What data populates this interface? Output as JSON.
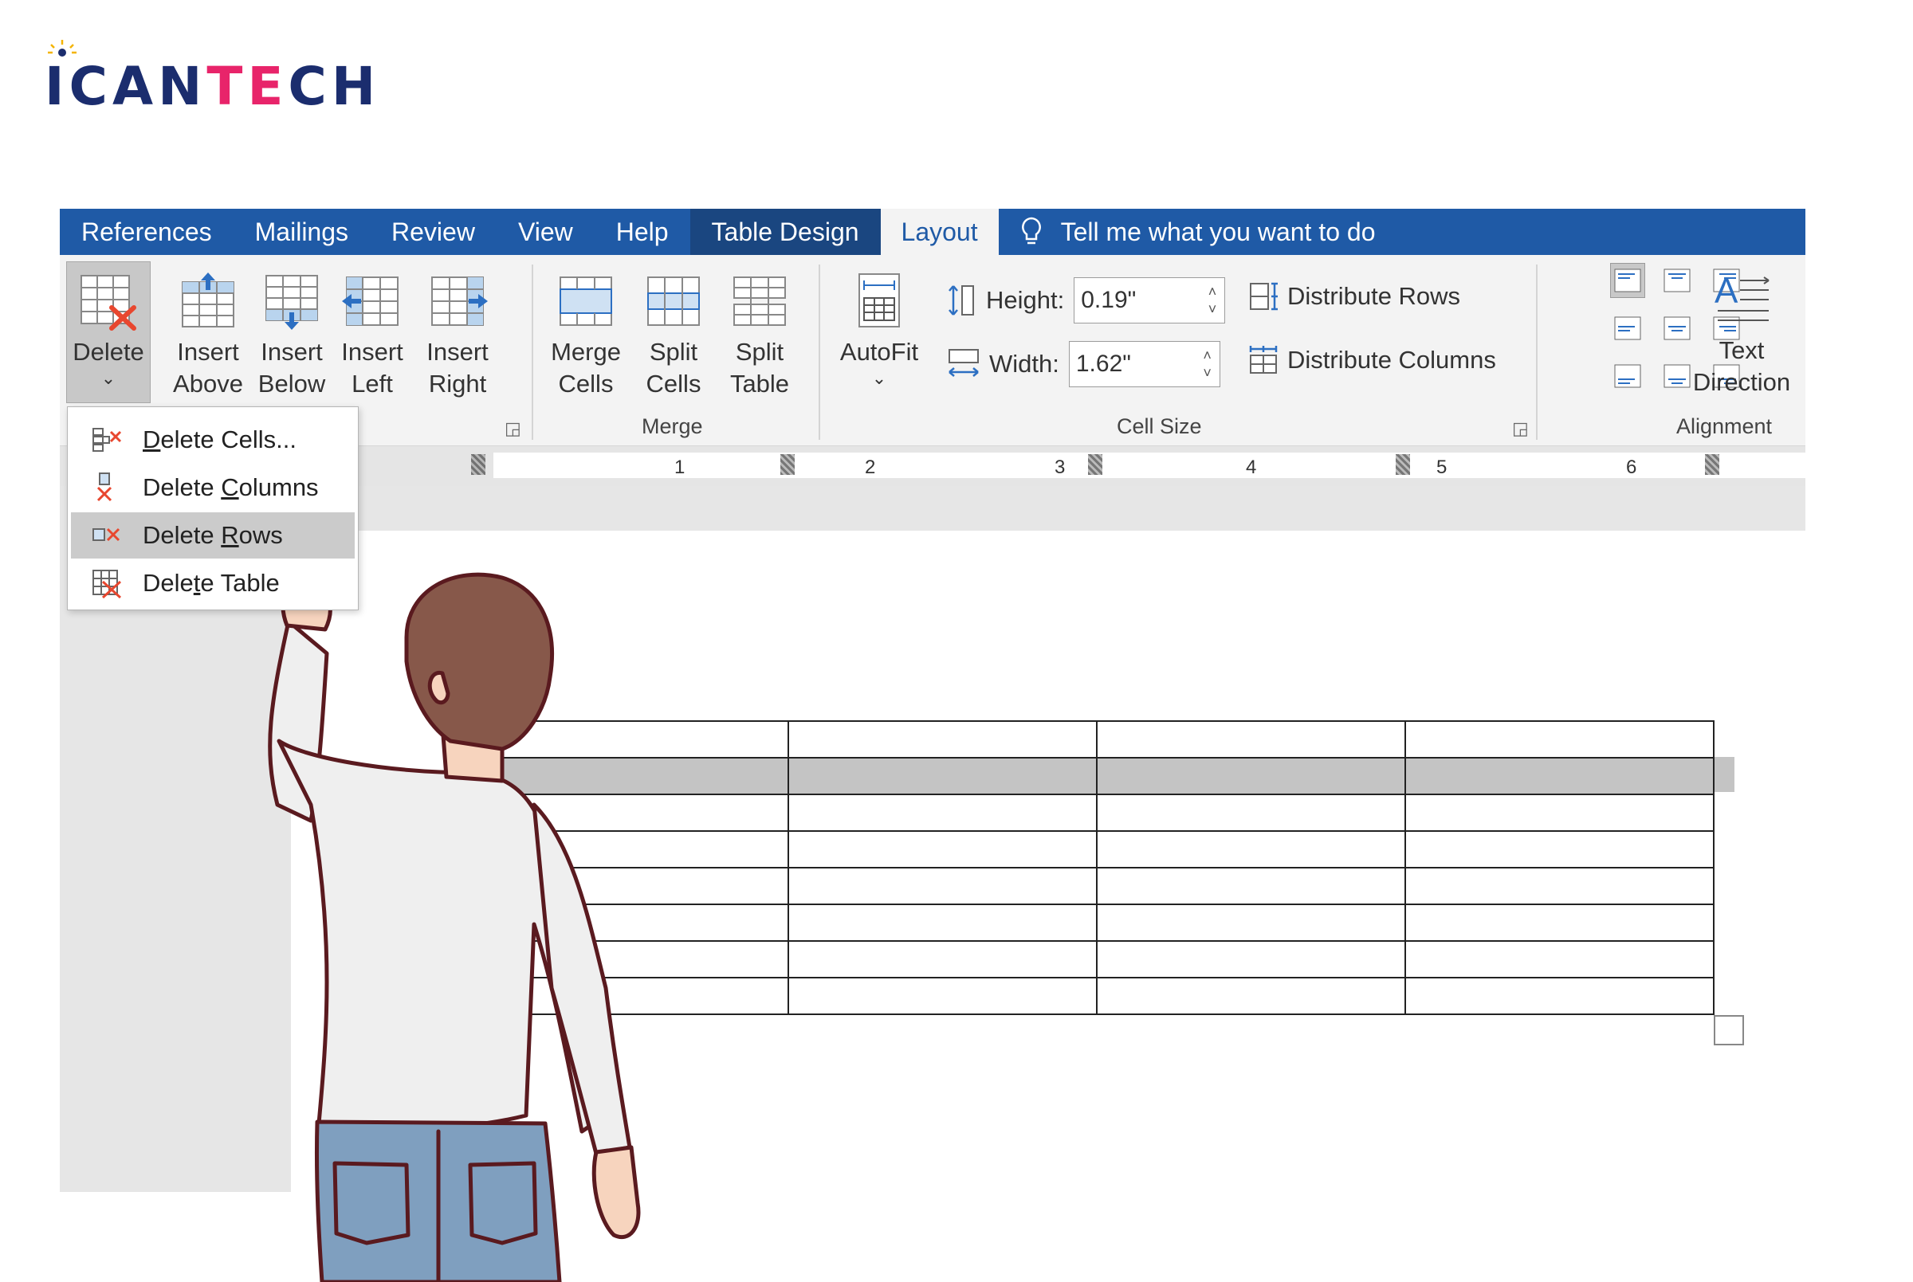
{
  "brand": {
    "logo_text_main": "ICAN",
    "logo_text_accent": "TE",
    "logo_text_end": "CH"
  },
  "tabs": [
    {
      "label": "References"
    },
    {
      "label": "Mailings"
    },
    {
      "label": "Review"
    },
    {
      "label": "View"
    },
    {
      "label": "Help"
    },
    {
      "label": "Table Design"
    },
    {
      "label": "Layout",
      "active": true
    }
  ],
  "tell_me": "Tell me what you want to do",
  "ribbon": {
    "rows_columns": {
      "delete": "Delete",
      "insert_above": [
        "Insert",
        "Above"
      ],
      "insert_below": [
        "Insert",
        "Below"
      ],
      "insert_left": [
        "Insert",
        "Left"
      ],
      "insert_right": [
        "Insert",
        "Right"
      ]
    },
    "merge": {
      "label": "Merge",
      "merge_cells": [
        "Merge",
        "Cells"
      ],
      "split_cells": [
        "Split",
        "Cells"
      ],
      "split_table": [
        "Split",
        "Table"
      ]
    },
    "cell_size": {
      "label": "Cell Size",
      "autofit": "AutoFit",
      "height_label": "Height:",
      "height_value": "0.19\"",
      "width_label": "Width:",
      "width_value": "1.62\"",
      "distribute_rows": "Distribute Rows",
      "distribute_columns": "Distribute Columns"
    },
    "alignment": {
      "label": "Alignment",
      "text_direction": [
        "Text",
        "Direction"
      ]
    }
  },
  "ruler": {
    "numbers": [
      "1",
      "2",
      "3",
      "4",
      "5",
      "6"
    ]
  },
  "delete_menu": {
    "items": [
      {
        "pre": "",
        "key": "D",
        "post": "elete Cells..."
      },
      {
        "pre": "Delete ",
        "key": "C",
        "post": "olumns"
      },
      {
        "pre": "Delete ",
        "key": "R",
        "post": "ows",
        "highlighted": true
      },
      {
        "pre": "Dele",
        "key": "t",
        "post": "e Table"
      }
    ]
  },
  "table": {
    "rows": 8,
    "columns": 4,
    "selected_row": 2
  },
  "colors": {
    "tab_bar": "#1f5aa6",
    "table_design_tab": "#1a4680",
    "ribbon_bg": "#f3f3f3",
    "selection": "#c4c4c4",
    "delete_x": "#e8472f"
  }
}
